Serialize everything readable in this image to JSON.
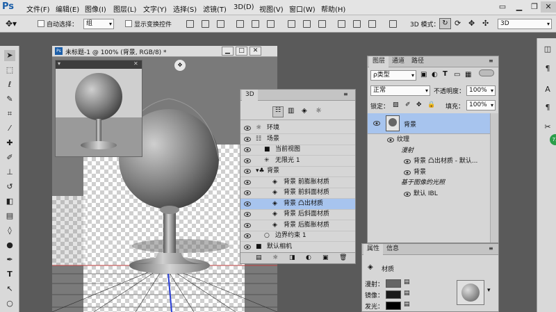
{
  "app": {
    "logo": "Ps",
    "window_controls": [
      "▭",
      "▁",
      "❐",
      "✕"
    ]
  },
  "menus": [
    "文件(F)",
    "编辑(E)",
    "图像(I)",
    "图层(L)",
    "文字(Y)",
    "选择(S)",
    "滤镜(T)",
    "3D(D)",
    "视图(V)",
    "窗口(W)",
    "帮助(H)"
  ],
  "options": {
    "auto_select": "自动选择：",
    "auto_select_value": "组",
    "show_transform": "显示变换控件",
    "mode_label": "3D 模式：",
    "workspace": "3D"
  },
  "document": {
    "title": "未标题-1 @ 100% (背景, RGB/8) *"
  },
  "panel3d": {
    "tab": "3D",
    "rows": [
      {
        "label": "环境",
        "indent": 0,
        "icon": "sun-icon"
      },
      {
        "label": "场景",
        "indent": 0,
        "icon": "scene-icon"
      },
      {
        "label": "当前视图",
        "indent": 1,
        "icon": "camera-icon"
      },
      {
        "label": "无限光 1",
        "indent": 1,
        "icon": "light-icon"
      },
      {
        "label": "背景",
        "indent": 0,
        "icon": "mesh-icon",
        "expanded": true
      },
      {
        "label": "背景 前膨胀材质",
        "indent": 2,
        "icon": "material-icon"
      },
      {
        "label": "背景 前斜面材质",
        "indent": 2,
        "icon": "material-icon"
      },
      {
        "label": "背景 凸出材质",
        "indent": 2,
        "icon": "material-icon",
        "selected": true
      },
      {
        "label": "背景 后斜面材质",
        "indent": 2,
        "icon": "material-icon"
      },
      {
        "label": "背景 后膨胀材质",
        "indent": 2,
        "icon": "material-icon"
      },
      {
        "label": "边界约束 1",
        "indent": 1,
        "icon": "constraint-icon"
      },
      {
        "label": "默认相机",
        "indent": 0,
        "icon": "camera-icon"
      }
    ]
  },
  "layers": {
    "tabs": [
      "图层",
      "通道",
      "路径"
    ],
    "filter_kind": "ρ类型",
    "blend_mode": "正常",
    "opacity_label": "不透明度：",
    "opacity": "100%",
    "lock_label": "锁定：",
    "fill_label": "填充：",
    "fill": "100%",
    "layer_name": "背景",
    "sub": [
      {
        "label": "纹理",
        "indent": 1,
        "italic": false,
        "eye": true
      },
      {
        "label": "漫射",
        "indent": 2,
        "italic": true,
        "eye": false
      },
      {
        "label": "背景 凸出材质 - 默认...",
        "indent": 3,
        "italic": false,
        "eye": true
      },
      {
        "label": "背景",
        "indent": 3,
        "italic": false,
        "eye": true
      },
      {
        "label": "基于图像的光照",
        "indent": 2,
        "italic": true,
        "eye": false
      },
      {
        "label": "默认 IBL",
        "indent": 3,
        "italic": false,
        "eye": true
      }
    ]
  },
  "properties": {
    "tabs": [
      "属性",
      "信息"
    ],
    "section": "材质",
    "rows": [
      {
        "label": "漫射：",
        "swatch": "#666666"
      },
      {
        "label": "镜像：",
        "swatch": "#1a1a1a"
      },
      {
        "label": "发光：",
        "swatch": "#000000"
      }
    ]
  },
  "canvas_badge": "3D"
}
